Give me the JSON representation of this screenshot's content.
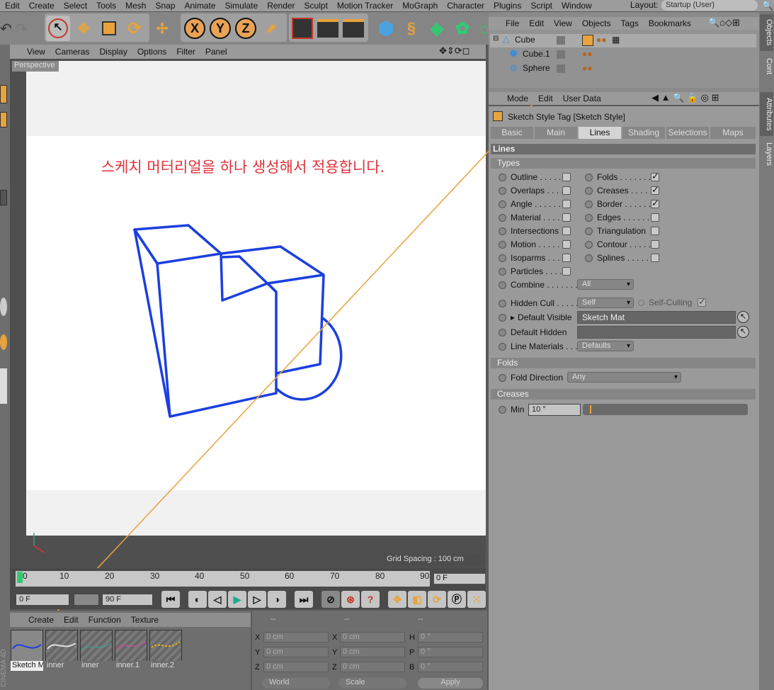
{
  "menubar": {
    "items": [
      "Edit",
      "Create",
      "Select",
      "Tools",
      "Mesh",
      "Snap",
      "Animate",
      "Simulate",
      "Render",
      "Sculpt",
      "Motion Tracker",
      "MoGraph",
      "Character",
      "Plugins",
      "Script",
      "Window"
    ],
    "layout_label": "Layout:",
    "layout_value": "Startup (User)"
  },
  "toolbar": {
    "axis_x": "X",
    "axis_y": "Y",
    "axis_z": "Z"
  },
  "viewport": {
    "menu": [
      "View",
      "Cameras",
      "Display",
      "Options",
      "Filter",
      "Panel"
    ],
    "camera_label": "Perspective",
    "note": "스케치 머터리얼을 하나 생성해서 적용합니다.",
    "grid_spacing": "Grid Spacing : 100 cm"
  },
  "timeline": {
    "ticks": [
      "0",
      "10",
      "20",
      "30",
      "40",
      "50",
      "60",
      "70",
      "80",
      "90"
    ],
    "end_frame_field": "0 F",
    "current_frame": "0 F",
    "max_frame": "90 F"
  },
  "materials": {
    "menu": [
      "Create",
      "Edit",
      "Function",
      "Texture"
    ],
    "items": [
      {
        "label": "Sketch M"
      },
      {
        "label": "inner"
      },
      {
        "label": "inner"
      },
      {
        "label": "inner.1"
      },
      {
        "label": "inner.2"
      }
    ]
  },
  "coords": {
    "headers": [
      "--",
      "--",
      "--"
    ],
    "rows": [
      {
        "a": "X",
        "av": "0 cm",
        "b": "X",
        "bv": "0 cm",
        "c": "H",
        "cv": "0 °"
      },
      {
        "a": "Y",
        "av": "0 cm",
        "b": "Y",
        "bv": "0 cm",
        "c": "P",
        "cv": "0 °"
      },
      {
        "a": "Z",
        "av": "0 cm",
        "b": "Z",
        "bv": "0 cm",
        "c": "B",
        "cv": "0 °"
      }
    ],
    "world": "World",
    "scale": "Scale",
    "apply": "Apply"
  },
  "objects": {
    "menu": [
      "File",
      "Edit",
      "View",
      "Objects",
      "Tags",
      "Bookmarks"
    ],
    "items": [
      {
        "name": "Cube"
      },
      {
        "name": "Cube.1"
      },
      {
        "name": "Sphere"
      }
    ]
  },
  "attributes": {
    "menu": [
      "Mode",
      "Edit",
      "User Data"
    ],
    "title": "Sketch Style Tag [Sketch Style]",
    "tabs": [
      "Basic",
      "Main",
      "Lines",
      "Shading",
      "Selections",
      "Maps"
    ],
    "active_tab": "Lines",
    "section": "Lines",
    "types_header": "Types",
    "left_types": [
      {
        "label": "Outline . . . . .",
        "checked": false
      },
      {
        "label": "Overlaps . . . .",
        "checked": false
      },
      {
        "label": "Angle . . . . . . .",
        "checked": false
      },
      {
        "label": "Material . . . .",
        "checked": false
      },
      {
        "label": "Intersections",
        "checked": false
      },
      {
        "label": "Motion . . . . . .",
        "checked": false
      },
      {
        "label": "Isoparms . . .",
        "checked": false
      },
      {
        "label": "Particles . . . .",
        "checked": false
      }
    ],
    "right_types": [
      {
        "label": "Folds . . . . . . . .",
        "checked": true
      },
      {
        "label": "Creases . . . . .",
        "checked": true
      },
      {
        "label": "Border . . . . . .",
        "checked": true
      },
      {
        "label": "Edges . . . . . . . .",
        "checked": false
      },
      {
        "label": "Triangulation",
        "checked": false
      },
      {
        "label": "Contour . . . . .",
        "checked": false
      },
      {
        "label": "Splines . . . . . .",
        "checked": false
      }
    ],
    "combine_label": "Combine . . . . . . . .",
    "combine_value": "All",
    "hidden_cull_label": "Hidden Cull . . . . .",
    "hidden_cull_value": "Self",
    "self_culling_label": "Self-Culling",
    "default_visible_label": "Default Visible",
    "default_visible_value": "Sketch Mat",
    "default_hidden_label": "Default Hidden",
    "line_materials_label": "Line Materials . . .",
    "line_materials_value": "Defaults",
    "folds_header": "Folds",
    "fold_direction_label": "Fold Direction",
    "fold_direction_value": "Any",
    "creases_header": "Creases",
    "min_label": "Min",
    "min_value": "10 °"
  },
  "side_tabs": [
    "Objects",
    "Cont",
    "Attributes",
    "Layers"
  ],
  "brand": "CINEMA 4D",
  "colors": {
    "accent_orange": "#e8a33c",
    "sketch_blue": "#1b3fe0",
    "note_red": "#e0323a"
  }
}
